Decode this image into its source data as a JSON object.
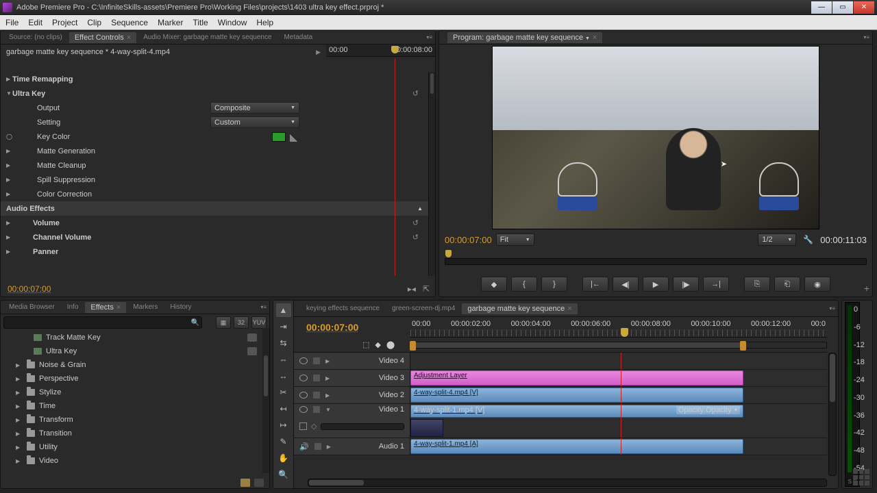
{
  "title": "Adobe Premiere Pro - C:\\InfiniteSkills-assets\\Premiere Pro\\Working Files\\projects\\1403 ultra key effect.prproj *",
  "menu": [
    "File",
    "Edit",
    "Project",
    "Clip",
    "Sequence",
    "Marker",
    "Title",
    "Window",
    "Help"
  ],
  "topLeftTabs": {
    "items": [
      "Source: (no clips)",
      "Effect Controls",
      "Audio Mixer: garbage matte key sequence",
      "Metadata"
    ],
    "activeIndex": 1
  },
  "effectControls": {
    "header": "garbage matte key sequence * 4-way-split-4.mp4",
    "rulerStart": "00:00",
    "rulerEnd": "00:00:08:00",
    "rows": [
      {
        "k": "timeRemap",
        "label": "Time Remapping",
        "bold": true,
        "tw": "▶"
      },
      {
        "k": "ultraKey",
        "label": "Ultra Key",
        "bold": true,
        "tw": "▼",
        "reset": true
      },
      {
        "k": "output",
        "label": "Output",
        "indent": 2,
        "combo": "Composite"
      },
      {
        "k": "setting",
        "label": "Setting",
        "indent": 2,
        "combo": "Custom"
      },
      {
        "k": "keyColor",
        "label": "Key Color",
        "indent": 2,
        "swatch": true,
        "o": true
      },
      {
        "k": "matteGen",
        "label": "Matte Generation",
        "indent": 2,
        "tw": "▶"
      },
      {
        "k": "matteClean",
        "label": "Matte Cleanup",
        "indent": 2,
        "tw": "▶"
      },
      {
        "k": "spill",
        "label": "Spill Suppression",
        "indent": 2,
        "tw": "▶"
      },
      {
        "k": "colorCorr",
        "label": "Color Correction",
        "indent": 2,
        "tw": "▶"
      }
    ],
    "audioHeader": "Audio Effects",
    "audioRows": [
      {
        "label": "Volume",
        "reset": true
      },
      {
        "label": "Channel Volume",
        "reset": true
      },
      {
        "label": "Panner"
      }
    ],
    "footTime": "00:00:07:00"
  },
  "program": {
    "tab": "Program: garbage matte key sequence",
    "curTime": "00:00:07:00",
    "fit": "Fit",
    "res": "1/2",
    "duration": "00:00:11:03"
  },
  "bottomLeftTabs": {
    "items": [
      "Media Browser",
      "Info",
      "Effects",
      "Markers",
      "History"
    ],
    "activeIndex": 2
  },
  "effectsPanel": {
    "btns": [
      "▦",
      "32",
      "YUV"
    ],
    "items": [
      {
        "label": "Track Matte Key",
        "leaf": true,
        "badge": true
      },
      {
        "label": "Ultra Key",
        "leaf": true,
        "badge": true
      },
      {
        "label": "Noise & Grain"
      },
      {
        "label": "Perspective"
      },
      {
        "label": "Stylize"
      },
      {
        "label": "Time"
      },
      {
        "label": "Transform"
      },
      {
        "label": "Transition"
      },
      {
        "label": "Utility"
      },
      {
        "label": "Video"
      }
    ]
  },
  "timeline": {
    "tabs": [
      "keying effects sequence",
      "green-screen-dj.mp4",
      "garbage matte key sequence"
    ],
    "activeTab": 2,
    "curTime": "00:00:07:00",
    "ticks": [
      "00:00",
      "00:00:02:00",
      "00:00:04:00",
      "00:00:06:00",
      "00:00:08:00",
      "00:00:10:00",
      "00:00:12:00",
      "00:0"
    ],
    "tracks": {
      "v4": "Video 4",
      "v3": {
        "name": "Video 3",
        "clip": "Adjustment Layer"
      },
      "v2": {
        "name": "Video 2",
        "clip": "4-way-split-4.mp4 [V]"
      },
      "v1": {
        "name": "Video 1",
        "clip": "4-way-split-1.mp4 [V]",
        "opacity": "Opacity:Opacity"
      },
      "a1": {
        "name": "Audio 1",
        "clip": "4-way-split-1.mp4 [A]"
      }
    }
  },
  "meters": {
    "ticks": [
      "0",
      "-6",
      "-12",
      "-18",
      "-24",
      "-30",
      "-36",
      "-42",
      "-48",
      "-54"
    ],
    "foot": "S  S"
  }
}
